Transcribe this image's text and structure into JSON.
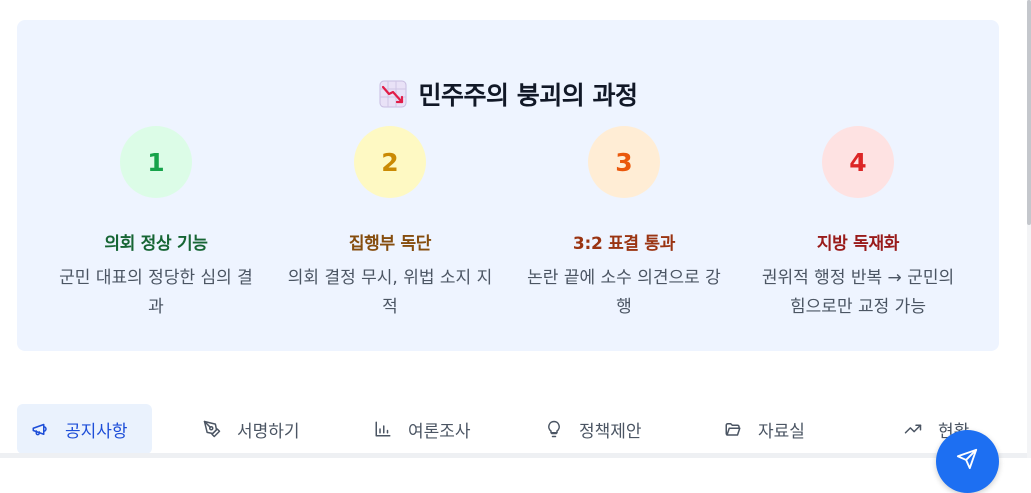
{
  "section": {
    "title": "민주주의 붕괴의 과정",
    "title_icon": "chart-decreasing-icon",
    "steps": [
      {
        "number": "1",
        "title": "의회 정상 기능",
        "desc": "군민 대표의 정당한 심의 결과",
        "bg": "#dcfce7",
        "num_color": "#16a34a",
        "title_color": "#166534"
      },
      {
        "number": "2",
        "title": "집행부 독단",
        "desc": "의회 결정 무시, 위법 소지 지적",
        "bg": "#fef9c3",
        "num_color": "#ca8a04",
        "title_color": "#854d0e"
      },
      {
        "number": "3",
        "title": "3:2 표결 통과",
        "desc": "논란 끝에 소수 의견으로 강행",
        "bg": "#ffedd5",
        "num_color": "#ea580c",
        "title_color": "#9a3412"
      },
      {
        "number": "4",
        "title": "지방 독재화",
        "desc": "권위적 행정 반복 → 군민의 힘으로만 교정 가능",
        "bg": "#fee2e2",
        "num_color": "#dc2626",
        "title_color": "#991b1b"
      }
    ]
  },
  "tabs": [
    {
      "label": "공지사항",
      "icon": "megaphone-icon",
      "active": true
    },
    {
      "label": "서명하기",
      "icon": "pen-icon",
      "active": false
    },
    {
      "label": "여론조사",
      "icon": "bar-chart-icon",
      "active": false
    },
    {
      "label": "정책제안",
      "icon": "lightbulb-icon",
      "active": false
    },
    {
      "label": "자료실",
      "icon": "folder-open-icon",
      "active": false
    },
    {
      "label": "현황",
      "icon": "trending-up-icon",
      "active": false
    }
  ],
  "colors": {
    "accent": "#1d4ed8",
    "card_bg": "#eef4ff",
    "fab": "#1d6ff2"
  }
}
